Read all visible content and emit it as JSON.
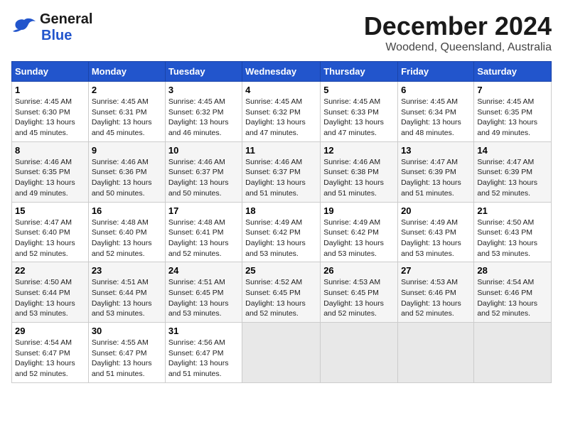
{
  "header": {
    "logo_general": "General",
    "logo_blue": "Blue",
    "month": "December 2024",
    "location": "Woodend, Queensland, Australia"
  },
  "weekdays": [
    "Sunday",
    "Monday",
    "Tuesday",
    "Wednesday",
    "Thursday",
    "Friday",
    "Saturday"
  ],
  "weeks": [
    [
      {
        "day": "1",
        "info": "Sunrise: 4:45 AM\nSunset: 6:30 PM\nDaylight: 13 hours\nand 45 minutes."
      },
      {
        "day": "2",
        "info": "Sunrise: 4:45 AM\nSunset: 6:31 PM\nDaylight: 13 hours\nand 45 minutes."
      },
      {
        "day": "3",
        "info": "Sunrise: 4:45 AM\nSunset: 6:32 PM\nDaylight: 13 hours\nand 46 minutes."
      },
      {
        "day": "4",
        "info": "Sunrise: 4:45 AM\nSunset: 6:32 PM\nDaylight: 13 hours\nand 47 minutes."
      },
      {
        "day": "5",
        "info": "Sunrise: 4:45 AM\nSunset: 6:33 PM\nDaylight: 13 hours\nand 47 minutes."
      },
      {
        "day": "6",
        "info": "Sunrise: 4:45 AM\nSunset: 6:34 PM\nDaylight: 13 hours\nand 48 minutes."
      },
      {
        "day": "7",
        "info": "Sunrise: 4:45 AM\nSunset: 6:35 PM\nDaylight: 13 hours\nand 49 minutes."
      }
    ],
    [
      {
        "day": "8",
        "info": "Sunrise: 4:46 AM\nSunset: 6:35 PM\nDaylight: 13 hours\nand 49 minutes."
      },
      {
        "day": "9",
        "info": "Sunrise: 4:46 AM\nSunset: 6:36 PM\nDaylight: 13 hours\nand 50 minutes."
      },
      {
        "day": "10",
        "info": "Sunrise: 4:46 AM\nSunset: 6:37 PM\nDaylight: 13 hours\nand 50 minutes."
      },
      {
        "day": "11",
        "info": "Sunrise: 4:46 AM\nSunset: 6:37 PM\nDaylight: 13 hours\nand 51 minutes."
      },
      {
        "day": "12",
        "info": "Sunrise: 4:46 AM\nSunset: 6:38 PM\nDaylight: 13 hours\nand 51 minutes."
      },
      {
        "day": "13",
        "info": "Sunrise: 4:47 AM\nSunset: 6:39 PM\nDaylight: 13 hours\nand 51 minutes."
      },
      {
        "day": "14",
        "info": "Sunrise: 4:47 AM\nSunset: 6:39 PM\nDaylight: 13 hours\nand 52 minutes."
      }
    ],
    [
      {
        "day": "15",
        "info": "Sunrise: 4:47 AM\nSunset: 6:40 PM\nDaylight: 13 hours\nand 52 minutes."
      },
      {
        "day": "16",
        "info": "Sunrise: 4:48 AM\nSunset: 6:40 PM\nDaylight: 13 hours\nand 52 minutes."
      },
      {
        "day": "17",
        "info": "Sunrise: 4:48 AM\nSunset: 6:41 PM\nDaylight: 13 hours\nand 52 minutes."
      },
      {
        "day": "18",
        "info": "Sunrise: 4:49 AM\nSunset: 6:42 PM\nDaylight: 13 hours\nand 53 minutes."
      },
      {
        "day": "19",
        "info": "Sunrise: 4:49 AM\nSunset: 6:42 PM\nDaylight: 13 hours\nand 53 minutes."
      },
      {
        "day": "20",
        "info": "Sunrise: 4:49 AM\nSunset: 6:43 PM\nDaylight: 13 hours\nand 53 minutes."
      },
      {
        "day": "21",
        "info": "Sunrise: 4:50 AM\nSunset: 6:43 PM\nDaylight: 13 hours\nand 53 minutes."
      }
    ],
    [
      {
        "day": "22",
        "info": "Sunrise: 4:50 AM\nSunset: 6:44 PM\nDaylight: 13 hours\nand 53 minutes."
      },
      {
        "day": "23",
        "info": "Sunrise: 4:51 AM\nSunset: 6:44 PM\nDaylight: 13 hours\nand 53 minutes."
      },
      {
        "day": "24",
        "info": "Sunrise: 4:51 AM\nSunset: 6:45 PM\nDaylight: 13 hours\nand 53 minutes."
      },
      {
        "day": "25",
        "info": "Sunrise: 4:52 AM\nSunset: 6:45 PM\nDaylight: 13 hours\nand 52 minutes."
      },
      {
        "day": "26",
        "info": "Sunrise: 4:53 AM\nSunset: 6:45 PM\nDaylight: 13 hours\nand 52 minutes."
      },
      {
        "day": "27",
        "info": "Sunrise: 4:53 AM\nSunset: 6:46 PM\nDaylight: 13 hours\nand 52 minutes."
      },
      {
        "day": "28",
        "info": "Sunrise: 4:54 AM\nSunset: 6:46 PM\nDaylight: 13 hours\nand 52 minutes."
      }
    ],
    [
      {
        "day": "29",
        "info": "Sunrise: 4:54 AM\nSunset: 6:47 PM\nDaylight: 13 hours\nand 52 minutes."
      },
      {
        "day": "30",
        "info": "Sunrise: 4:55 AM\nSunset: 6:47 PM\nDaylight: 13 hours\nand 51 minutes."
      },
      {
        "day": "31",
        "info": "Sunrise: 4:56 AM\nSunset: 6:47 PM\nDaylight: 13 hours\nand 51 minutes."
      },
      null,
      null,
      null,
      null
    ]
  ]
}
